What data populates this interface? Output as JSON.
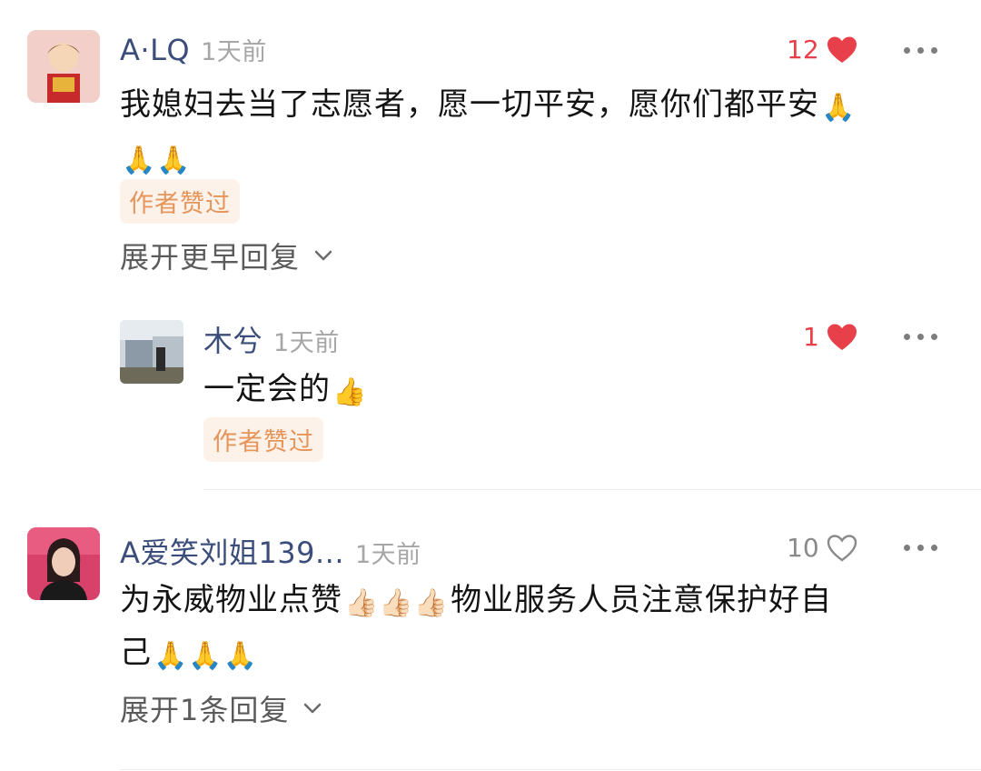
{
  "comments": [
    {
      "username": "A·LQ",
      "time": "1天前",
      "likes": "12",
      "liked": true,
      "text_line1": "我媳妇去当了志愿者，愿一切平安，愿你们都平安",
      "emoji_1": "🙏",
      "emoji_2": "🙏🙏",
      "badge": "作者赞过",
      "expand": "展开更早回复"
    },
    {
      "username": "木兮",
      "time": "1天前",
      "likes": "1",
      "liked": true,
      "text": "一定会的",
      "emoji": "👍",
      "badge": "作者赞过"
    },
    {
      "username": "A爱笑刘姐139...",
      "time": "1天前",
      "likes": "10",
      "liked": false,
      "text_a": "为永威物业点赞",
      "emoji_a": "👍🏻👍🏻👍🏻",
      "text_b": "物业服务人员注意保护好自",
      "text_c": "己",
      "emoji_c": "🙏🙏🙏",
      "expand": "展开1条回复"
    }
  ]
}
